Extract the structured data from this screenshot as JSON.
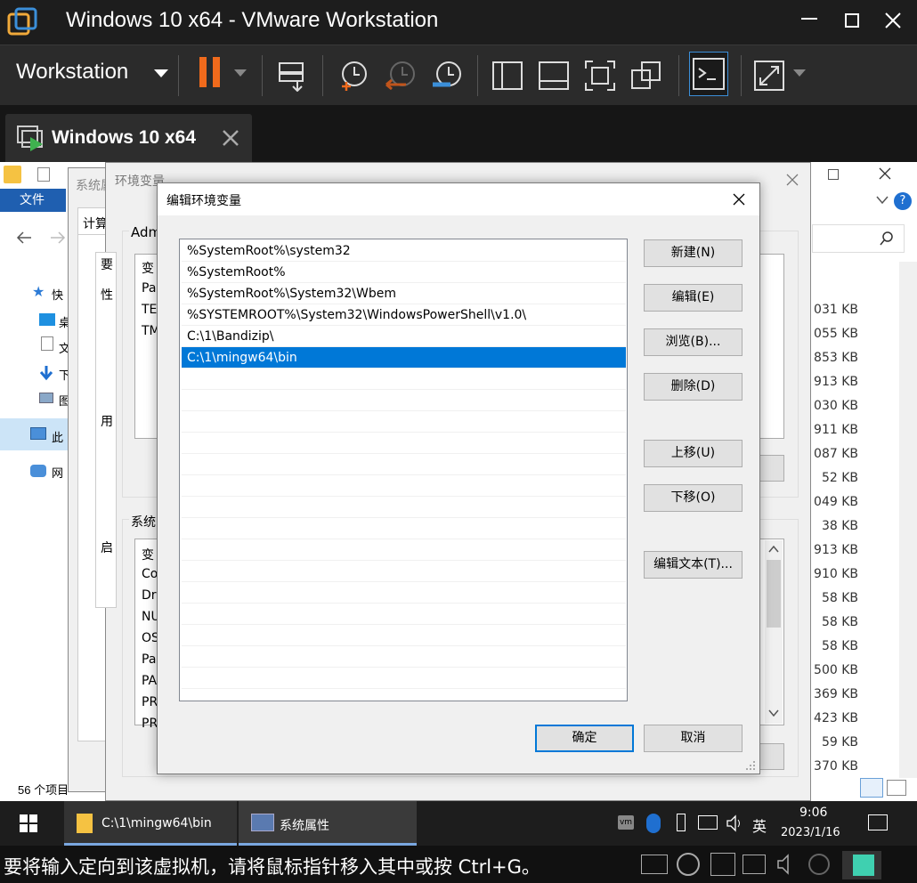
{
  "vmware": {
    "window_title": "Windows 10 x64 - VMware Workstation",
    "menu_label": "Workstation",
    "tab_label": "Windows 10 x64"
  },
  "explorer": {
    "file_tab": "文件",
    "nav_quick": "快",
    "nav_desktop": "桌",
    "nav_docs": "文",
    "nav_down": "下",
    "nav_pics": "图",
    "nav_thispc": "此",
    "nav_network": "网",
    "item_count": "56 个项目",
    "sizes": [
      "031 KB",
      "055 KB",
      "853 KB",
      "913 KB",
      "030 KB",
      "911 KB",
      "087 KB",
      "52 KB",
      "049 KB",
      "38 KB",
      "913 KB",
      "910 KB",
      "58 KB",
      "58 KB",
      "58 KB",
      "500 KB",
      "369 KB",
      "423 KB",
      "59 KB",
      "370 KB"
    ]
  },
  "sysprops": {
    "title": "系统属",
    "tab": "计算"
  },
  "envvars": {
    "title": "环境变量",
    "user_group": "Adm",
    "user_col": "变",
    "user_rows": [
      "Pa",
      "TE",
      "TM"
    ],
    "sys_group": "系统",
    "sys_col": "变",
    "sys_rows": [
      "Co",
      "Dr",
      "NU",
      "OS",
      "Pa",
      "PA",
      "PR",
      "PR"
    ],
    "left_labels": [
      "要",
      "性",
      "用",
      "启"
    ]
  },
  "editor": {
    "title": "编辑环境变量",
    "entries": [
      "%SystemRoot%\\system32",
      "%SystemRoot%",
      "%SystemRoot%\\System32\\Wbem",
      "%SYSTEMROOT%\\System32\\WindowsPowerShell\\v1.0\\",
      "C:\\1\\Bandizip\\",
      "C:\\1\\mingw64\\bin"
    ],
    "selected_index": 5,
    "buttons": {
      "new": "新建(N)",
      "edit": "编辑(E)",
      "browse": "浏览(B)...",
      "delete": "删除(D)",
      "up": "上移(U)",
      "down": "下移(O)",
      "edit_text": "编辑文本(T)...",
      "ok": "确定",
      "cancel": "取消"
    }
  },
  "taskbar": {
    "item1": "C:\\1\\mingw64\\bin",
    "item2": "系统属性",
    "ime": "英",
    "time": "9:06",
    "date": "2023/1/16"
  },
  "status": {
    "message": "要将输入定向到该虚拟机，请将鼠标指针移入其中或按 Ctrl+G。"
  },
  "colors": {
    "accent": "#0078d7",
    "pause": "#f06a1c",
    "vm_play": "#3fb24f"
  }
}
